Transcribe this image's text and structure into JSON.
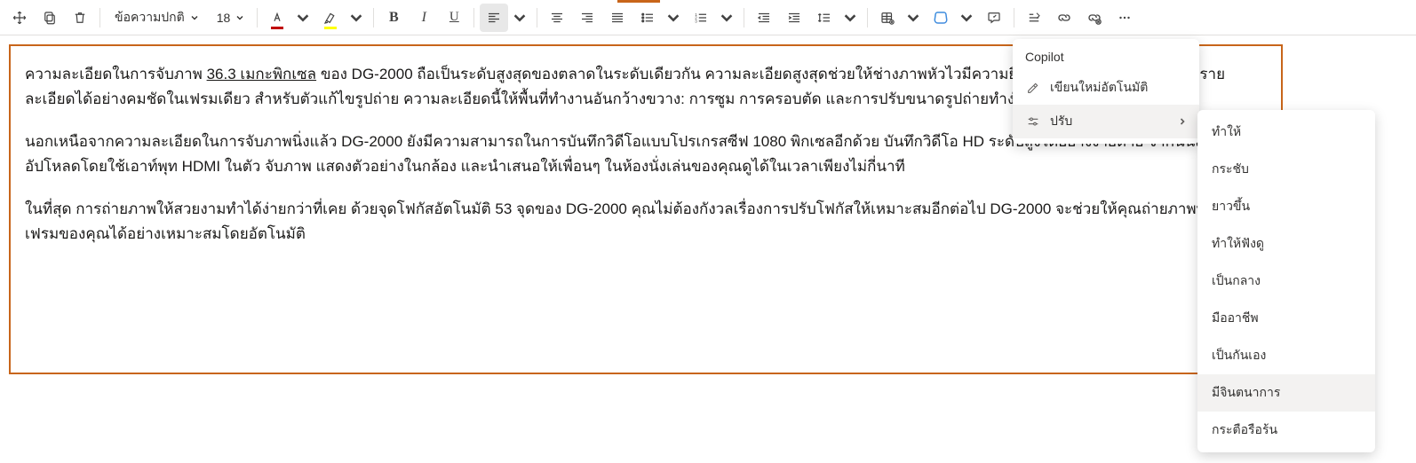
{
  "toolbar": {
    "style_label": "ข้อความปกติ",
    "font_size": "18",
    "bold": "B",
    "italic": "I",
    "underline": "U"
  },
  "document": {
    "para1_a": "ความละเอียดในการจับภาพ ",
    "para1_u": "36.3 เมกะพิกเซล",
    "para1_b": " ของ DG-2000 ถือเป็นระดับสูงสุดของตลาดในระดับเดียวกัน ความละเอียดสูงสุดช่วยให้ช่างภาพหัวไวมีความยืดหยุ่นเพียงพอที่จะจับภาพทุกรายละเอียดได้อย่างคมชัดในเฟรมเดียว สำหรับตัวแก้ไขรูปถ่าย ความละเอียดนี้ให้พื้นที่ทำงานอันกว้างขวาง: การซูม การครอบตัด และการปรับขนาดรูปถ่ายทำง่ายกว่าที่เคย",
    "para2": "นอกเหนือจากความละเอียดในการจับภาพนิ่งแล้ว DG-2000 ยังมีความสามารถในการบันทึกวิดีโอแบบโปรเกรสซีฟ 1080 พิกเซลอีกด้วย บันทึกวิดีโอ HD ระดับสูงได้อย่างง่ายดาย จากนั้นถึงดูและอัปโหลดโดยใช้เอาท์พุท HDMI ในตัว จับภาพ แสดงตัวอย่างในกล้อง และนำเสนอให้เพื่อนๆ ในห้องนั่งเล่นของคุณดูได้ในเวลาเพียงไม่กี่นาที",
    "para3": "ในที่สุด การถ่ายภาพให้สวยงามทำได้ง่ายกว่าที่เคย ด้วยจุดโฟกัสอัตโนมัติ 53 จุดของ DG-2000 คุณไม่ต้องกังวลเรื่องการปรับโฟกัสให้เหมาะสมอีกต่อไป DG-2000 จะช่วยให้คุณถ่ายภาพทุกภาพในเฟรมของคุณได้อย่างเหมาะสมโดยอัตโนมัติ"
  },
  "menu1": {
    "title": "Copilot",
    "rewrite": "เขียนใหม่อัตโนมัติ",
    "adjust": "ปรับ"
  },
  "menu2": {
    "items": [
      "ทำให้",
      "กระชับ",
      "ยาวขึ้น",
      "ทำให้ฟังดู",
      "เป็นกลาง",
      "มืออาชีพ",
      "เป็นกันเอง",
      "มีจินตนาการ",
      "กระตือรือร้น"
    ],
    "hover_index": 7
  }
}
